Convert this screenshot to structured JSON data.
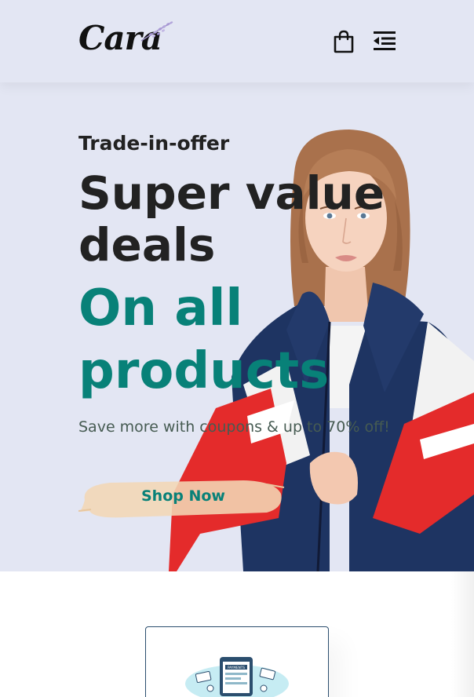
{
  "header": {
    "logo_text": "Cara",
    "icons": {
      "bag": "shopping-bag-icon",
      "menu": "menu-outdent-icon"
    }
  },
  "hero": {
    "offer": "Trade-in-offer",
    "headline": "Super value deals",
    "headline_accent": "On all products",
    "subtext": "Save more with coupons & up to 70% off!",
    "cta_label": "Shop Now"
  },
  "feature": {
    "card_label": "PAYMENTS"
  },
  "colors": {
    "background": "#e3e6f3",
    "accent": "#088178",
    "text_dark": "#222222",
    "button_brush": "#f2d7b5",
    "card_border": "#2b4e6e"
  }
}
